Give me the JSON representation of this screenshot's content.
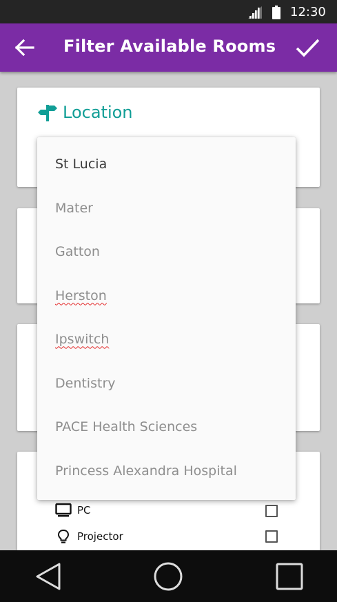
{
  "status_bar": {
    "time": "12:30",
    "icons": [
      "signal-icon",
      "battery-icon"
    ]
  },
  "app_bar": {
    "title": "Filter Available Rooms",
    "back_icon": "arrow-left-icon",
    "confirm_icon": "checkmark-icon",
    "color": "#7b2ca5"
  },
  "location_card": {
    "label": "Location",
    "icon": "signpost-icon",
    "accent_color": "#119e96"
  },
  "location_dropdown": {
    "selected": "St Lucia",
    "options": [
      {
        "label": "St Lucia",
        "selected": true
      },
      {
        "label": "Mater",
        "selected": false
      },
      {
        "label": "Gatton",
        "selected": false
      },
      {
        "label": "Herston",
        "selected": false,
        "spellcheck": true
      },
      {
        "label": "Ipswitch",
        "selected": false,
        "spellcheck": true
      },
      {
        "label": "Dentistry",
        "selected": false
      },
      {
        "label": "PACE Health Sciences",
        "selected": false
      },
      {
        "label": "Princess Alexandra Hospital",
        "selected": false
      }
    ]
  },
  "equipment": {
    "items": [
      {
        "label": "PC",
        "icon": "monitor-icon",
        "checked": false
      },
      {
        "label": "Projector",
        "icon": "lightbulb-icon",
        "checked": false
      }
    ]
  },
  "nav_bar": {
    "icons": [
      "back-triangle-icon",
      "home-circle-icon",
      "recents-square-icon"
    ]
  }
}
